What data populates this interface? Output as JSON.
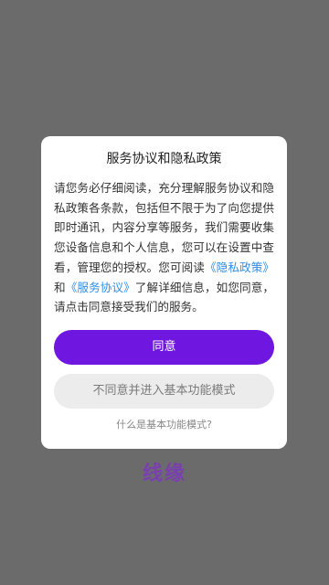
{
  "app": {
    "brand_text": "线缘"
  },
  "dialog": {
    "title": "服务协议和隐私政策",
    "body_part1": "请您务必仔细阅读，充分理解服务协议和隐私政策各条款，包括但不限于为了向您提供即时通讯，内容分享等服务，我们需要收集您设备信息和个人信息，您可以在设置中查看，管理您的授权。您可阅读",
    "privacy_link": "《隐私政策》",
    "and_text": "和",
    "service_link": "《服务协议》",
    "body_part2": "了解详细信息，如您同意，请点击同意接受我们的服务。",
    "agree_label": "同意",
    "disagree_label": "不同意并进入基本功能模式",
    "basic_mode_question": "什么是基本功能模式?"
  },
  "colors": {
    "overlay": "#6b6b6b",
    "primary": "#6f17e0",
    "link": "#2f8ee6",
    "brand": "#7a3fb0"
  }
}
